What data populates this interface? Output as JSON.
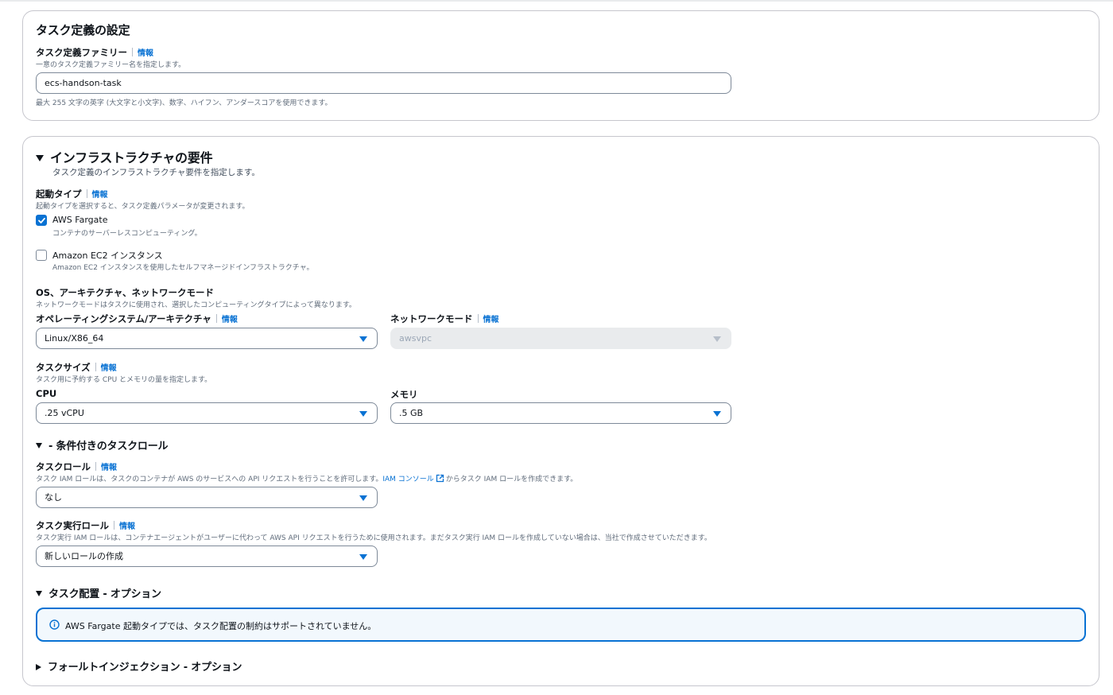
{
  "task_definition": {
    "title": "タスク定義の設定",
    "family_label": "タスク定義ファミリー",
    "info": "情報",
    "family_desc": "一意のタスク定義ファミリー名を指定します。",
    "family_value": "ecs-handson-task",
    "family_hint": "最大 255 文字の英字 (大文字と小文字)、数字、ハイフン、アンダースコアを使用できます。"
  },
  "infra": {
    "title": "インフラストラクチャの要件",
    "subtitle": "タスク定義のインフラストラクチャ要件を指定します。",
    "launch_type_label": "起動タイプ",
    "info": "情報",
    "launch_type_desc": "起動タイプを選択すると、タスク定義パラメータが変更されます。",
    "options": [
      {
        "label": "AWS Fargate",
        "desc": "コンテナのサーバーレスコンピューティング。",
        "checked": true
      },
      {
        "label": "Amazon EC2 インスタンス",
        "desc": "Amazon EC2 インスタンスを使用したセルフマネージドインフラストラクチャ。",
        "checked": false
      }
    ],
    "os_section_label": "OS、アーキテクチャ、ネットワークモード",
    "os_section_desc": "ネットワークモードはタスクに使用され、選択したコンピューティングタイプによって異なります。",
    "os_label": "オペレーティングシステム/アーキテクチャ",
    "os_value": "Linux/X86_64",
    "network_label": "ネットワークモード",
    "network_value": "awsvpc",
    "task_size_label": "タスクサイズ",
    "task_size_desc": "タスク用に予約する CPU とメモリの量を指定します。",
    "cpu_label": "CPU",
    "cpu_value": ".25 vCPU",
    "memory_label": "メモリ",
    "memory_value": ".5 GB"
  },
  "task_role_section": {
    "title": "- 条件付きのタスクロール",
    "task_role_label": "タスクロール",
    "info": "情報",
    "task_role_desc_before": "タスク IAM ロールは、タスクのコンテナが AWS のサービスへの API リクエストを行うことを許可します。",
    "iam_console_link": "IAM コンソール",
    "task_role_desc_after": "からタスク IAM ロールを作成できます。",
    "task_role_value": "なし",
    "exec_role_label": "タスク実行ロール",
    "exec_role_desc": "タスク実行 IAM ロールは、コンテナエージェントがユーザーに代わって AWS API リクエストを行うために使用されます。まだタスク実行 IAM ロールを作成していない場合は、当社で作成させていただきます。",
    "exec_role_value": "新しいロールの作成"
  },
  "placement": {
    "title": "タスク配置 - オプション",
    "alert": "AWS Fargate 起動タイプでは、タスク配置の制約はサポートされていません。"
  },
  "fault_injection": {
    "title": "フォールトインジェクション - オプション"
  },
  "colors": {
    "accent": "#0972d3",
    "border": "#c6c6cd",
    "text": "#0f141a",
    "muted": "#5f6b7a"
  }
}
